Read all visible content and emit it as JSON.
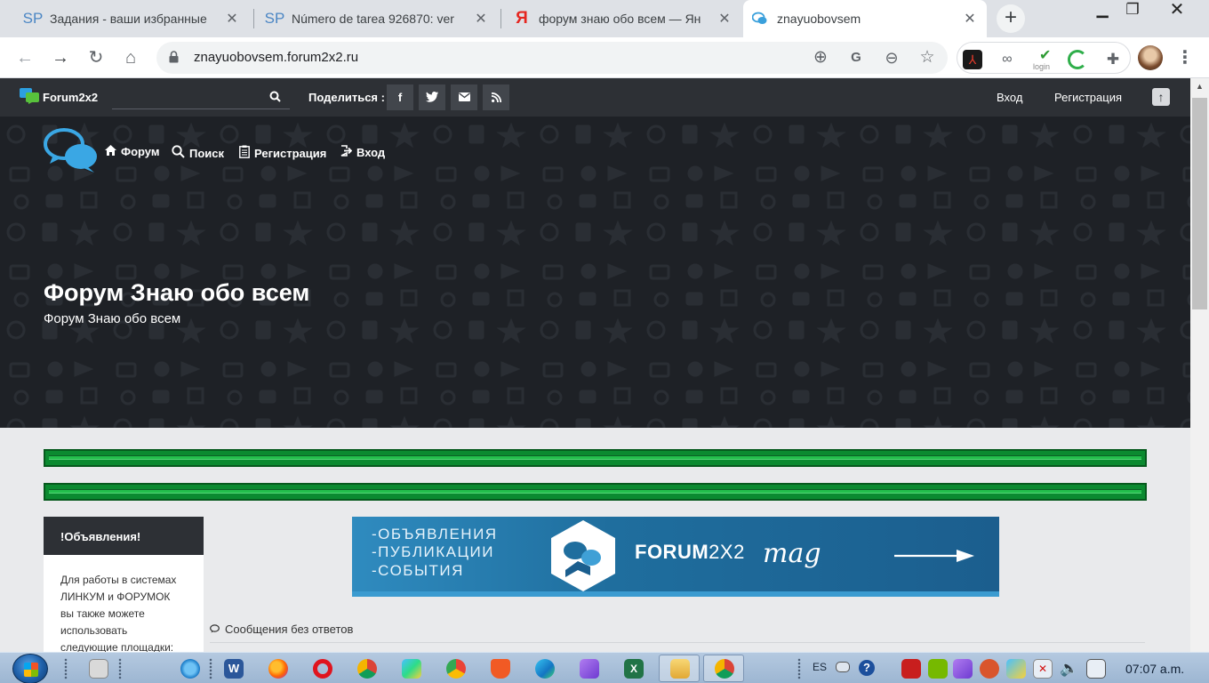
{
  "browser": {
    "tabs": [
      {
        "title": "Задания - ваши избранные",
        "favicon": "SP"
      },
      {
        "title": "Número de tarea 926870: ver",
        "favicon": "SP"
      },
      {
        "title": "форум знаю обо всем — Ян",
        "favicon": "Я"
      },
      {
        "title": "znayuobovsem",
        "favicon": "chat-bubble"
      }
    ],
    "url": "znayuobovsem.forum2x2.ru",
    "ext_login_label": "login"
  },
  "topbar": {
    "brand": "Forum2x2",
    "search_placeholder": "",
    "share_label": "Поделиться :",
    "share_icons": [
      "f",
      "t",
      "✉",
      "rss"
    ],
    "login": "Вход",
    "register": "Регистрация"
  },
  "hero": {
    "nav": [
      {
        "icon": "home-icon",
        "glyph": "⌂",
        "label": "Форум"
      },
      {
        "icon": "search-icon",
        "glyph": "⚲",
        "label": "Поиск"
      },
      {
        "icon": "clipboard-icon",
        "glyph": "▤",
        "label": "Регистрация"
      },
      {
        "icon": "login-icon",
        "glyph": "⇥",
        "label": "Вход"
      }
    ],
    "title": "Форум Знаю обо всем",
    "subtitle": "Форум Знаю обо всем"
  },
  "sidebar": {
    "title": "!Объявления!",
    "lines": [
      "Для работы в системах",
      "ЛИНКУМ и ФОРУМОК",
      "вы также можете",
      "использовать",
      "следующие площадки:"
    ]
  },
  "banner": {
    "lines": [
      "-ОБЪЯВЛЕНИЯ",
      "-ПУБЛИКАЦИИ",
      "-СОБЫТИЯ"
    ],
    "brand_bold": "FORUM",
    "brand_light": "2X2",
    "mag": "mag"
  },
  "content": {
    "unanswered": "Сообщения без ответов"
  },
  "taskbar": {
    "lang": "ES",
    "clock": "07:07 a.m."
  },
  "colors": {
    "forum_bar": "#2d3035",
    "hero_bg": "#1e2126",
    "green_bar": "#0b8a30",
    "page_bg": "#e9eaec"
  }
}
